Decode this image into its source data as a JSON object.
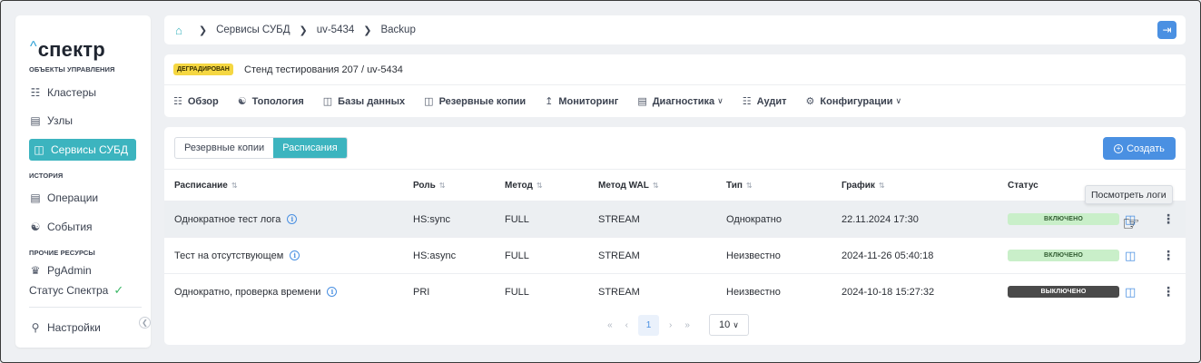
{
  "logo": {
    "caret": "^",
    "text": "спектр"
  },
  "sidebar": {
    "section_objects": "ОБЪЕКТЫ УПРАВЛЕНИЯ",
    "section_history": "ИСТОРИЯ",
    "section_other": "ПРОЧИЕ РЕСУРСЫ",
    "items": [
      {
        "label": "Кластеры",
        "icon": "cluster-icon"
      },
      {
        "label": "Узлы",
        "icon": "server-icon"
      },
      {
        "label": "Сервисы СУБД",
        "icon": "database-service-icon"
      },
      {
        "label": "Операции",
        "icon": "operations-icon"
      },
      {
        "label": "События",
        "icon": "events-icon"
      },
      {
        "label": "PgAdmin",
        "icon": "pgadmin-icon"
      },
      {
        "label": "Статус Спектра",
        "icon": "check-icon"
      },
      {
        "label": "Настройки",
        "icon": "user-icon"
      }
    ]
  },
  "breadcrumb": [
    "Сервисы СУБД",
    "uv-5434",
    "Backup"
  ],
  "header": {
    "badge": "ДЕГРАДИРОВАН",
    "title": "Стенд тестирования 207 / uv-5434",
    "tabs": [
      "Обзор",
      "Топология",
      "Базы данных",
      "Резервные копии",
      "Мониторинг",
      "Диагностика",
      "Аудит",
      "Конфигурации"
    ]
  },
  "segment": {
    "backups": "Резервные копии",
    "schedules": "Расписания"
  },
  "create_label": "Создать",
  "table": {
    "columns": [
      "Расписание",
      "Роль",
      "Метод",
      "Метод WAL",
      "Тип",
      "График",
      "Статус"
    ],
    "rows": [
      {
        "name": "Однократное тест лога",
        "role": "HS:sync",
        "method": "FULL",
        "wal": "STREAM",
        "type": "Однократно",
        "schedule": "22.11.2024 17:30",
        "status": "ВКЛЮЧЕНО"
      },
      {
        "name": "Тест на отсутствующем",
        "role": "HS:async",
        "method": "FULL",
        "wal": "STREAM",
        "type": "Неизвестно",
        "schedule": "2024-11-26 05:40:18",
        "status": "ВКЛЮЧЕНО"
      },
      {
        "name": "Однократно, проверка времени",
        "role": "PRI",
        "method": "FULL",
        "wal": "STREAM",
        "type": "Неизвестно",
        "schedule": "2024-10-18 15:27:32",
        "status": "ВЫКЛЮЧЕНО"
      }
    ]
  },
  "tooltip": "Посмотреть логи",
  "pagination": {
    "current": "1",
    "page_size": "10"
  },
  "colors": {
    "teal": "#3cb4bf",
    "blue": "#4a90e2",
    "badge_yellow": "#f5d742",
    "status_on": "#c9efc9",
    "status_off": "#4a4a4a"
  }
}
